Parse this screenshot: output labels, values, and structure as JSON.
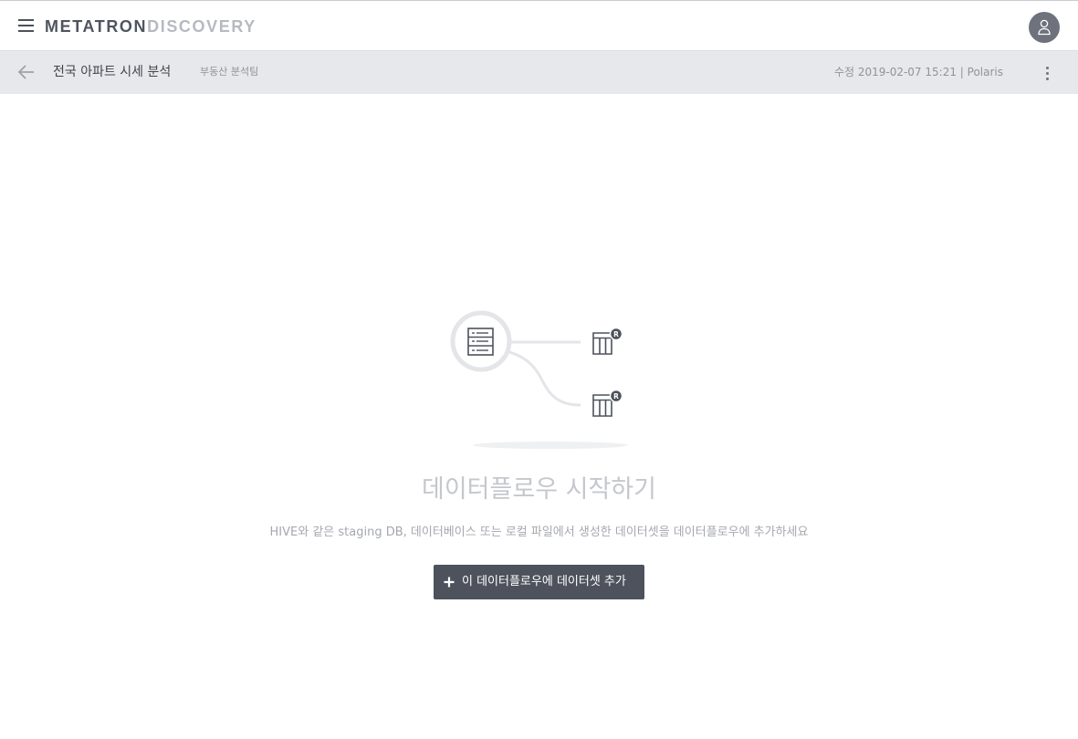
{
  "header": {
    "logo_primary": "METATRON",
    "logo_secondary": "DISCOVERY",
    "menu_icon": "hamburger-menu-icon",
    "user_icon": "user-avatar-icon"
  },
  "workbench": {
    "title": "전국 아파트 시세 분석",
    "description": "부동산 분석팀",
    "modified": "수정 2019-02-07 15:21 | Polaris"
  },
  "empty_state": {
    "title": "데이터플로우 시작하기",
    "description": "HIVE와 같은 staging DB, 데이터베이스 또는 로컬 파일에서 생성한 데이터셋을 데이터플로우에 추가하세요",
    "add_button_label": "이 데이터플로우에 데이터셋 추가",
    "dataset_badge": "R"
  },
  "colors": {
    "accent_dark": "#4d525c",
    "subbar_bg": "#e7e8ec",
    "muted_text": "#c5c7cd"
  }
}
